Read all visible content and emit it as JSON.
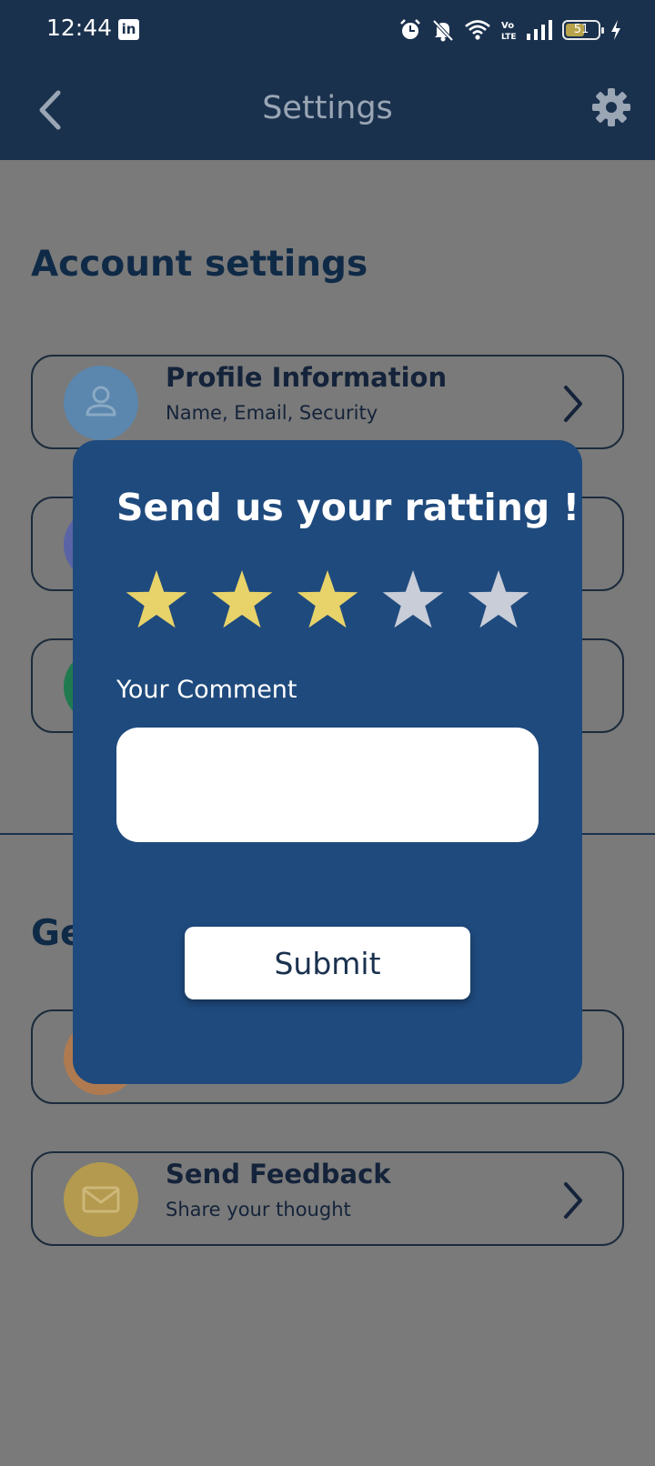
{
  "status_bar": {
    "time": "12:44",
    "battery": "51"
  },
  "app_bar": {
    "title": "Settings"
  },
  "sections": {
    "account_title": "Account settings",
    "general_title_partial": "Ge"
  },
  "cards": {
    "profile": {
      "title": "Profile Information",
      "subtitle": "Name, Email, Security",
      "avatar_color": "#5b86ad"
    },
    "feedback": {
      "title": "Send Feedback",
      "subtitle": "Share your thought",
      "avatar_color": "#b49a4e"
    }
  },
  "modal": {
    "title": "Send us your ratting !",
    "rating": {
      "value": 3,
      "max": 5,
      "filled_color": "#e8d36a",
      "empty_color": "#c8cdd8"
    },
    "comment_label": "Your Comment",
    "comment_value": "",
    "submit_label": "Submit"
  },
  "colors": {
    "header": "#1a314e",
    "modal": "#1f4a7d",
    "scrim": "#7a7a7a"
  },
  "icons": {
    "back": "chevron-left-icon",
    "settings": "gear-icon",
    "profile": "person-icon",
    "feedback": "mail-icon",
    "row_action": "chevron-right-icon"
  }
}
